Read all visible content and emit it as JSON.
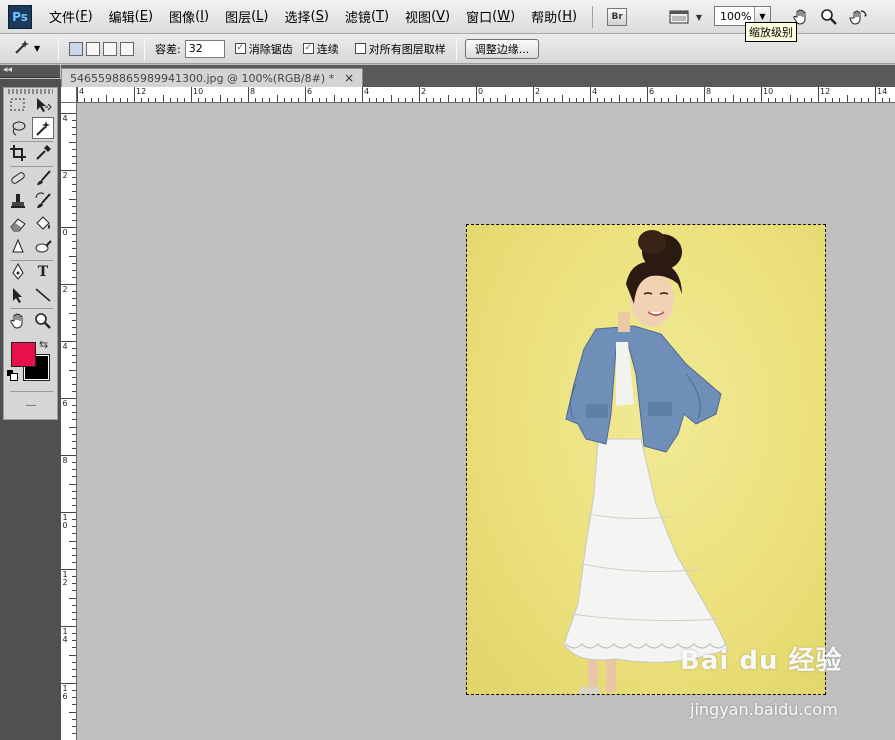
{
  "app": {
    "logo": "Ps"
  },
  "menu": [
    {
      "label": "文件",
      "key": "F"
    },
    {
      "label": "编辑",
      "key": "E"
    },
    {
      "label": "图像",
      "key": "I"
    },
    {
      "label": "图层",
      "key": "L"
    },
    {
      "label": "选择",
      "key": "S"
    },
    {
      "label": "滤镜",
      "key": "T"
    },
    {
      "label": "视图",
      "key": "V"
    },
    {
      "label": "窗口",
      "key": "W"
    },
    {
      "label": "帮助",
      "key": "H"
    }
  ],
  "menubar_tools": {
    "bridge_label": "Br",
    "zoom_value": "100%",
    "tooltip": "缩放级别"
  },
  "options": {
    "tolerance_label": "容差:",
    "tolerance_value": "32",
    "antialias_label": "消除锯齿",
    "antialias_checked": true,
    "contiguous_label": "连续",
    "contiguous_checked": true,
    "sample_all_label": "对所有图层取样",
    "sample_all_checked": false,
    "refine_edge_label": "调整边缘..."
  },
  "document": {
    "tab_title": "546559886598994130​0.jpg @ 100%(RGB/8#) *",
    "close_glyph": "×"
  },
  "colors": {
    "foreground": "#e8104a",
    "background": "#000000",
    "photo_bg": "#ebe07a",
    "jacket": "#6f8fb8",
    "dress": "#f4f4f2"
  },
  "rulers": {
    "horizontal_labels": [
      "4",
      "12",
      "10",
      "8",
      "6",
      "4",
      "2",
      "0",
      "2",
      "4",
      "6",
      "8",
      "10",
      "12",
      "14"
    ],
    "vertical_labels": [
      "4",
      "2",
      "0",
      "2",
      "4",
      "6",
      "8",
      "10",
      "12",
      "14",
      "16"
    ]
  },
  "watermark": {
    "main": "Bai du 经验",
    "url": "jingyan.baidu.com"
  }
}
